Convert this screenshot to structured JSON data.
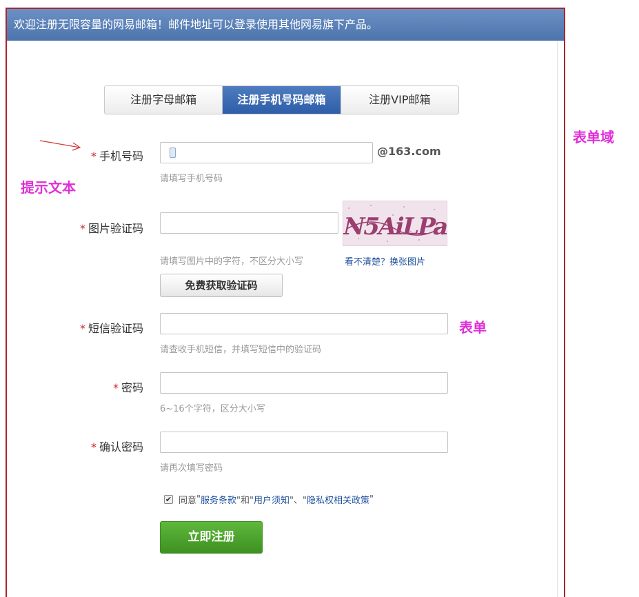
{
  "header": {
    "text": "欢迎注册无限容量的网易邮箱！邮件地址可以登录使用其他网易旗下产品。"
  },
  "tabs": [
    {
      "label": "注册字母邮箱",
      "active": false
    },
    {
      "label": "注册手机号码邮箱",
      "active": true
    },
    {
      "label": "注册VIP邮箱",
      "active": false
    }
  ],
  "fields": {
    "phone": {
      "star": "*",
      "label": "手机号码",
      "value": "",
      "suffix": "@163.com",
      "hint": "请填写手机号码"
    },
    "captcha": {
      "star": "*",
      "label": "图片验证码",
      "value": "",
      "hint": "请填写图片中的字符，不区分大小写",
      "refresh": "看不清楚？换张图片",
      "image_text": "N5AiLPa"
    },
    "get_code_button": "免费获取验证码",
    "sms": {
      "star": "*",
      "label": "短信验证码",
      "value": "",
      "hint": "请查收手机短信，并填写短信中的验证码"
    },
    "password": {
      "star": "*",
      "label": "密码",
      "value": "",
      "hint": "6~16个字符，区分大小写"
    },
    "confirm": {
      "star": "*",
      "label": "确认密码",
      "value": "",
      "hint": "请再次填写密码"
    }
  },
  "agreement": {
    "checked": true,
    "check_mark": "✔",
    "prefix": "同意",
    "q1": "\"",
    "terms": "服务条款",
    "mid1": "\"和\"",
    "notice": "用户须知",
    "mid2": "\"、\"",
    "privacy": "隐私权相关政策",
    "q2": "\""
  },
  "submit_button": "立即注册",
  "annotations": {
    "form_area": "表单域",
    "hint_text": "提示文本",
    "form": "表单"
  },
  "colors": {
    "header": "#5a80b8",
    "tab_active": "#3a69b3",
    "star": "#c8252e",
    "annotation": "#e02fd8",
    "submit": "#4aa52c",
    "frame": "#a7252e"
  }
}
